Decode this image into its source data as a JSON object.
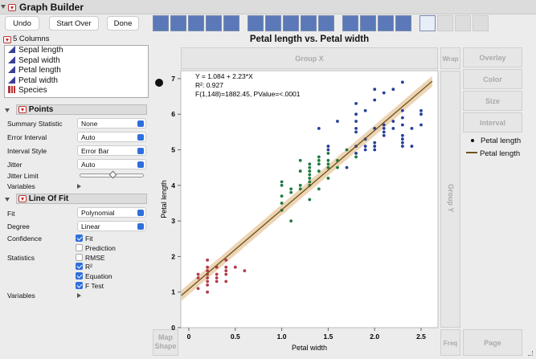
{
  "window": {
    "title": "Graph Builder"
  },
  "toolbar": {
    "undo": "Undo",
    "start_over": "Start Over",
    "done": "Done",
    "tools": [
      "points",
      "smoother",
      "line-of-fit",
      "ellipse",
      "contour",
      "line",
      "bar",
      "area",
      "box-plot",
      "histogram",
      "heatmap",
      "pie",
      "treemap",
      "mosaic",
      "caption-box",
      "formula",
      "map-shapes",
      "parallel"
    ]
  },
  "columns": {
    "header": "5 Columns",
    "items": [
      {
        "label": "Sepal length",
        "type": "continuous"
      },
      {
        "label": "Sepal width",
        "type": "continuous"
      },
      {
        "label": "Petal length",
        "type": "continuous"
      },
      {
        "label": "Petal width",
        "type": "continuous"
      },
      {
        "label": "Species",
        "type": "nominal"
      }
    ]
  },
  "points": {
    "title": "Points",
    "summary_statistic_label": "Summary Statistic",
    "summary_statistic": "None",
    "error_interval_label": "Error Interval",
    "error_interval": "Auto",
    "interval_style_label": "Interval Style",
    "interval_style": "Error Bar",
    "jitter_label": "Jitter",
    "jitter": "Auto",
    "jitter_limit_label": "Jitter Limit",
    "jitter_limit": 0.5,
    "variables_label": "Variables"
  },
  "line_of_fit": {
    "title": "Line Of Fit",
    "fit_label": "Fit",
    "fit": "Polynomial",
    "degree_label": "Degree",
    "degree": "Linear",
    "confidence_label": "Confidence",
    "conf_fit": "Fit",
    "conf_prediction": "Prediction",
    "statistics_label": "Statistics",
    "rmse": "RMSE",
    "r2": "R²",
    "equation": "Equation",
    "ftest": "F Test",
    "variables_label": "Variables"
  },
  "zones": {
    "group_x": "Group X",
    "group_y": "Group Y",
    "wrap": "Wrap",
    "overlay": "Overlay",
    "color": "Color",
    "size": "Size",
    "interval": "Interval",
    "map_shape_1": "Map",
    "map_shape_2": "Shape",
    "freq": "Freq",
    "page": "Page"
  },
  "legend": {
    "points": "Petal length",
    "line": "Petal length"
  },
  "annotation": {
    "equation": "Y = 1.084 + 2.23*X",
    "r2": "R²: 0.927",
    "ftest": "F(1,148)=1882.45, PValue=<.0001"
  },
  "colors": {
    "setosa": "#b23a4a",
    "versicolor": "#1e7b40",
    "virginica": "#23409a",
    "fit": "#6b5318",
    "band": "#e9c9a2"
  },
  "chart_data": {
    "type": "scatter",
    "title": "Petal length vs. Petal width",
    "xlabel": "Petal width",
    "ylabel": "Petal length",
    "xlim": [
      -0.1,
      2.65
    ],
    "ylim": [
      0,
      7.2
    ],
    "xticks": [
      "0",
      "0.5",
      "1.0",
      "1.5",
      "2.0",
      "2.5"
    ],
    "yticks": [
      "0",
      "1",
      "2",
      "3",
      "4",
      "5",
      "6",
      "7"
    ],
    "fit": {
      "intercept": 1.084,
      "slope": 2.23
    },
    "series": [
      {
        "name": "setosa",
        "points": [
          [
            0.1,
            1.1
          ],
          [
            0.1,
            1.4
          ],
          [
            0.1,
            1.5
          ],
          [
            0.2,
            1.0
          ],
          [
            0.2,
            1.2
          ],
          [
            0.2,
            1.3
          ],
          [
            0.2,
            1.4
          ],
          [
            0.2,
            1.5
          ],
          [
            0.2,
            1.6
          ],
          [
            0.2,
            1.7
          ],
          [
            0.2,
            1.9
          ],
          [
            0.3,
            1.3
          ],
          [
            0.3,
            1.4
          ],
          [
            0.3,
            1.5
          ],
          [
            0.3,
            1.7
          ],
          [
            0.4,
            1.3
          ],
          [
            0.4,
            1.5
          ],
          [
            0.4,
            1.6
          ],
          [
            0.4,
            1.7
          ],
          [
            0.4,
            1.9
          ],
          [
            0.5,
            1.7
          ],
          [
            0.6,
            1.6
          ]
        ]
      },
      {
        "name": "versicolor",
        "points": [
          [
            1.0,
            3.3
          ],
          [
            1.0,
            3.5
          ],
          [
            1.0,
            3.7
          ],
          [
            1.0,
            4.0
          ],
          [
            1.0,
            4.1
          ],
          [
            1.1,
            3.0
          ],
          [
            1.1,
            3.8
          ],
          [
            1.1,
            3.9
          ],
          [
            1.2,
            3.9
          ],
          [
            1.2,
            4.0
          ],
          [
            1.2,
            4.4
          ],
          [
            1.2,
            4.7
          ],
          [
            1.3,
            3.6
          ],
          [
            1.3,
            4.0
          ],
          [
            1.3,
            4.1
          ],
          [
            1.3,
            4.2
          ],
          [
            1.3,
            4.3
          ],
          [
            1.3,
            4.4
          ],
          [
            1.3,
            4.5
          ],
          [
            1.3,
            4.6
          ],
          [
            1.4,
            3.9
          ],
          [
            1.4,
            4.4
          ],
          [
            1.4,
            4.6
          ],
          [
            1.4,
            4.7
          ],
          [
            1.4,
            4.8
          ],
          [
            1.5,
            4.2
          ],
          [
            1.5,
            4.5
          ],
          [
            1.5,
            4.6
          ],
          [
            1.5,
            4.7
          ],
          [
            1.5,
            4.9
          ],
          [
            1.6,
            4.5
          ],
          [
            1.6,
            4.7
          ],
          [
            1.7,
            5.0
          ],
          [
            1.8,
            4.8
          ]
        ]
      },
      {
        "name": "virginica",
        "points": [
          [
            1.4,
            5.6
          ],
          [
            1.5,
            5.0
          ],
          [
            1.5,
            5.1
          ],
          [
            1.6,
            5.8
          ],
          [
            1.7,
            4.5
          ],
          [
            1.8,
            4.9
          ],
          [
            1.8,
            5.1
          ],
          [
            1.8,
            5.5
          ],
          [
            1.8,
            5.6
          ],
          [
            1.8,
            5.8
          ],
          [
            1.8,
            6.0
          ],
          [
            1.8,
            6.3
          ],
          [
            1.9,
            5.0
          ],
          [
            1.9,
            5.1
          ],
          [
            1.9,
            5.3
          ],
          [
            1.9,
            6.1
          ],
          [
            2.0,
            5.0
          ],
          [
            2.0,
            5.1
          ],
          [
            2.0,
            5.2
          ],
          [
            2.0,
            5.6
          ],
          [
            2.0,
            6.4
          ],
          [
            2.0,
            6.7
          ],
          [
            2.1,
            5.4
          ],
          [
            2.1,
            5.5
          ],
          [
            2.1,
            5.6
          ],
          [
            2.1,
            5.7
          ],
          [
            2.1,
            6.6
          ],
          [
            2.2,
            5.6
          ],
          [
            2.2,
            5.8
          ],
          [
            2.2,
            6.7
          ],
          [
            2.3,
            5.1
          ],
          [
            2.3,
            5.2
          ],
          [
            2.3,
            5.3
          ],
          [
            2.3,
            5.4
          ],
          [
            2.3,
            5.7
          ],
          [
            2.3,
            5.9
          ],
          [
            2.3,
            6.1
          ],
          [
            2.3,
            6.9
          ],
          [
            2.4,
            5.1
          ],
          [
            2.4,
            5.6
          ],
          [
            2.5,
            5.7
          ],
          [
            2.5,
            6.0
          ],
          [
            2.5,
            6.1
          ]
        ]
      }
    ]
  }
}
